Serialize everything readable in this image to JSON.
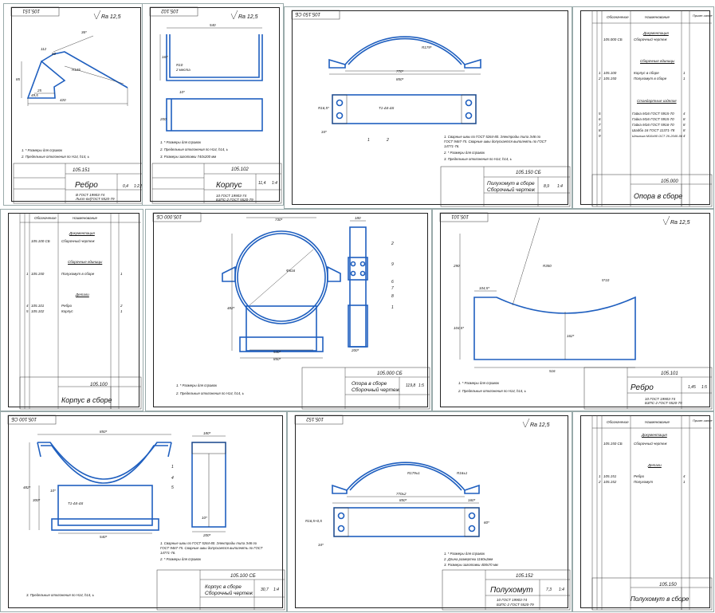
{
  "sheets": {
    "rebro_top": {
      "code_rot": "105.151",
      "roughness": "Ra 12,5",
      "dims": [
        "36*",
        "150",
        "R125",
        "85",
        "25",
        "112",
        "49,5",
        "420",
        "50"
      ],
      "notes": [
        "1. * Размеры для справок",
        "2. Предельные отклонения по Н14, h14, ±"
      ],
      "tol": "IT14",
      "tol_den": "2",
      "designation": "105.151",
      "name": "Ребро",
      "material1": "В ГОСТ 19903-74",
      "material2": "Лист 6х(ГОСТ 5520-79",
      "mass": "0,4",
      "scale": "1:2,5"
    },
    "korpus": {
      "code_rot": "105.102",
      "roughness": "Ra 12,5",
      "dims": [
        "540",
        "167",
        "R10",
        "2 места",
        "10*",
        "200"
      ],
      "notes": [
        "1. * Размеры для справок",
        "2. Предельные отклонения по Н14, h14, ±",
        "3. Размеры заготовки 740х200 мм"
      ],
      "designation": "105.102",
      "name": "Корпус",
      "material1": "10 ГОСТ 19903-74",
      "material2": "Б3ПС-2 ГОСТ 5520-79",
      "mass": "11,4",
      "scale": "1:4"
    },
    "poluhomut_sb": {
      "code_rot": "105.150 СБ",
      "dims": [
        "R179*",
        "770*",
        "850*",
        "R16,5*",
        "34*",
        "11*",
        "60*",
        "10*",
        "1",
        "2"
      ],
      "weld": "Т1-Δ5-Δ5",
      "notes": [
        "1. Сварные швы по ГОСТ 5264-80. Электроды типа Э46 по",
        "ГОСТ 9467-75. Сварные швы допускается выполнять по ГОСТ",
        "14771-76.",
        "2. * Размеры для справок",
        "3. Предельные отклонения по Н14, h14, ±"
      ],
      "designation": "105.150 СБ",
      "name1": "Полухомут в сборе",
      "name2": "Сборочный чертеж",
      "mass": "8,9",
      "scale": "1:4"
    },
    "opora_spec": {
      "col1": "Обозначение",
      "col2": "Наименование",
      "col3": "Приме-чание",
      "sections": [
        "Документация",
        "Сборочные единицы",
        "Стандартные изделия"
      ],
      "rows": [
        {
          "pos": "",
          "des": "105.000 СБ",
          "name": "Сборочный чертеж",
          "qty": ""
        },
        {
          "pos": "1",
          "des": "105.100",
          "name": "Корпус в сборе",
          "qty": "1"
        },
        {
          "pos": "2",
          "des": "105.150",
          "name": "Полухомут в сборе",
          "qty": "1"
        },
        {
          "pos": "5",
          "des": "",
          "name": "Гайка М16 ГОСТ 5915-70",
          "qty": "4"
        },
        {
          "pos": "6",
          "des": "",
          "name": "Гайка М16 ГОСТ 5915-70",
          "qty": "8"
        },
        {
          "pos": "7",
          "des": "",
          "name": "Гайка М16 ГОСТ 5916-70",
          "qty": "8"
        },
        {
          "pos": "8",
          "des": "",
          "name": "Шайба 16 ГОСТ 11371-78",
          "qty": "8"
        },
        {
          "pos": "9",
          "des": "",
          "name": "Шпилька М16х90 ОСТ 26-2040-96",
          "qty": "4"
        }
      ],
      "designation": "105.000",
      "name": "Опора в сборе"
    },
    "korpus_spec": {
      "sections": [
        "Документация",
        "Сборочные единицы",
        "Детали"
      ],
      "rows": [
        {
          "pos": "",
          "des": "105.100 СБ",
          "name": "Сборочный чертеж",
          "qty": ""
        },
        {
          "pos": "1",
          "des": "105.150",
          "name": "Полухомут в сборе",
          "qty": "1"
        },
        {
          "pos": "4",
          "des": "105.101",
          "name": "Ребро",
          "qty": "2"
        },
        {
          "pos": "5",
          "des": "105.102",
          "name": "Корпус",
          "qty": "1"
        }
      ],
      "designation": "105.100",
      "name": "Корпус в сборе"
    },
    "opora_sb": {
      "code_rot": "105.000 СБ",
      "dims": [
        "730*",
        "180",
        "Ф616",
        "482*",
        "540*",
        "850*",
        "200*",
        "2",
        "9",
        "6",
        "7",
        "8",
        "1"
      ],
      "notes": [
        "1. * Размеры для справок",
        "2. Предельные отклонения по Н14, h14, ±"
      ],
      "designation": "105.000 СБ",
      "name1": "Опора в сборе",
      "name2": "Сборочный чертеж",
      "mass": "119,8",
      "scale": "1:5"
    },
    "rebro_mid": {
      "code_rot": "105.101",
      "roughness": "Ra 12,5",
      "dims": [
        "290",
        "R350",
        "5*10",
        "104,5*",
        "200",
        "162*",
        "516"
      ],
      "notes": [
        "1. * Размеры для справок",
        "2. Предельные отклонения по Н14, h14, ±"
      ],
      "designation": "105.101",
      "name": "Ребро",
      "material1": "10 ГОСТ 19903-74",
      "material2": "Б3ПС-2 ГОСТ 5520-79",
      "mass": "1,45",
      "scale": "1:5"
    },
    "korpus_sb": {
      "code_rot": "105.100 СБ",
      "dims": [
        "850*",
        "180*",
        "482*",
        "300*",
        "10*",
        "540*",
        "200*",
        "10*",
        "1",
        "4",
        "5"
      ],
      "weld": "Т1-Δ5-Δ5",
      "notes": [
        "1. Сварные швы по ГОСТ 5264-80. Электроды типа Э46 по",
        "ГОСТ 9467-75. Сварные швы допускается выполнять по ГОСТ",
        "14771-76.",
        "2. * Размеры для справок",
        "3. Предельные отклонения по Н14, h14, ±"
      ],
      "designation": "105.100 СБ",
      "name1": "Корпус в сборе",
      "name2": "Сборочный чертеж",
      "mass": "30,7",
      "scale": "1:4"
    },
    "poluhomut": {
      "code_rot": "105.152",
      "roughness": "Ra 12,5",
      "dims": [
        "R179±1",
        "R16±1",
        "770±2",
        "850*",
        "R16,5+0,5",
        "34*",
        "10*",
        "60*",
        "160*"
      ],
      "notes": [
        "1. * Размеры для справок",
        "2. Длина развертки 1160±2мм",
        "3. Размеры заготовки 408х70 мм"
      ],
      "designation": "105.152",
      "name": "Полухомут",
      "material1": "10 ГОСТ 19903-74",
      "material2": "Б3ПС-2 ГОСТ 5520-79",
      "mass": "7,3",
      "scale": "1:4"
    },
    "poluhomut_spec": {
      "sections": [
        "Документация",
        "Детали"
      ],
      "rows": [
        {
          "pos": "",
          "des": "105.150 СБ",
          "name": "Сборочный чертеж",
          "qty": ""
        },
        {
          "pos": "1",
          "des": "105.151",
          "name": "Ребро",
          "qty": "4"
        },
        {
          "pos": "2",
          "des": "105.152",
          "name": "Полухомут",
          "qty": "1"
        }
      ],
      "designation": "105.150",
      "name": "Полухомут в сборе"
    }
  }
}
